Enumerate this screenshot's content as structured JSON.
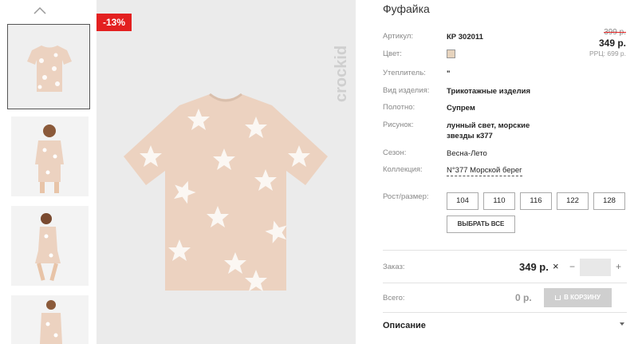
{
  "gallery": {
    "thumbnails": [
      {
        "name": "thumbnail-shirt-flat"
      },
      {
        "name": "thumbnail-model-front"
      },
      {
        "name": "thumbnail-model-side"
      },
      {
        "name": "thumbnail-model-back"
      }
    ],
    "selected_index": 0,
    "discount_badge": "-13%",
    "brand_logo": "crockid"
  },
  "product": {
    "title": "Фуфайка",
    "rows": [
      {
        "label": "Артикул:",
        "value": "КР 302011"
      },
      {
        "label": "Цвет:",
        "value": ""
      },
      {
        "label": "Утеплитель:",
        "value": "\""
      },
      {
        "label": "Вид изделия:",
        "value": "Трикотажные изделия"
      },
      {
        "label": "Полотно:",
        "value": "Супрем"
      },
      {
        "label": "Рисунок:",
        "value": "лунный свет, морские звезды к377"
      },
      {
        "label": "Сезон:",
        "value": "Весна-Лето"
      },
      {
        "label": "Коллекция:",
        "value": "N°377 Морской берег"
      }
    ],
    "swatch_color": "#e6d3bd",
    "price_old": "399 р.",
    "price_new": "349 р.",
    "price_rrp": "РРЦ: 699 р."
  },
  "sizes": {
    "label": "Рост/размер:",
    "options": [
      "104",
      "110",
      "116",
      "122",
      "128"
    ],
    "select_all": "ВЫБРАТЬ ВСЕ"
  },
  "order": {
    "label": "Заказ:",
    "price": "349 р.",
    "times": "×",
    "minus": "−",
    "plus": "+",
    "quantity": ""
  },
  "total": {
    "label": "Всего:",
    "value": "0 р.",
    "cart_button": "В КОРЗИНУ"
  },
  "description": {
    "label": "Описание"
  },
  "colors": {
    "accent_red": "#e32020",
    "shirt_peach": "#ecd2c0",
    "cart_disabled": "#cfcfcf"
  }
}
